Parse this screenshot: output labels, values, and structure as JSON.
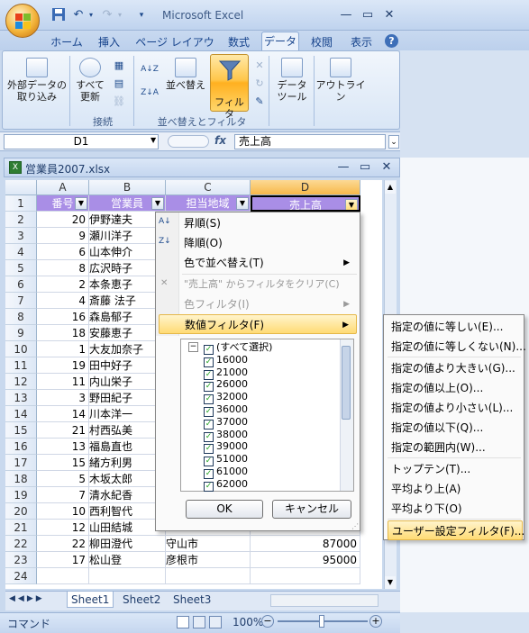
{
  "app": {
    "title": "Microsoft Excel",
    "workbook": "営業員2007.xlsx"
  },
  "qat": [
    "save-icon",
    "undo-icon",
    "redo-icon",
    "customize-icon"
  ],
  "window_controls": [
    "minimize",
    "restore",
    "close"
  ],
  "tabs": [
    "ホーム",
    "挿入",
    "ページ レイアウト",
    "数式",
    "データ",
    "校閲",
    "表示"
  ],
  "active_tab": "データ",
  "ribbon": {
    "external_data": "外部データの取り込み",
    "refresh_all_l1": "すべて",
    "refresh_all_l2": "更新",
    "group_connections": "接続",
    "sort": "並べ替え",
    "filter": "フィルタ",
    "group_sort_filter": "並べ替えとフィルタ",
    "data_tools_l1": "データ",
    "data_tools_l2": "ツール",
    "outline": "アウトライン",
    "sort_az": "A↓Z",
    "sort_za": "Z↓A"
  },
  "formula": {
    "namebox": "D1",
    "fx": "fx",
    "value": "売上高"
  },
  "columns": [
    "A",
    "B",
    "C",
    "D"
  ],
  "rows": [
    {
      "n": "1",
      "a": "番号",
      "b": "営業員",
      "c": "担当地域",
      "d": "売上高"
    },
    {
      "n": "2",
      "a": "20",
      "b": "伊野達夫",
      "c": "",
      "d": ""
    },
    {
      "n": "3",
      "a": "9",
      "b": "瀬川洋子",
      "c": "",
      "d": ""
    },
    {
      "n": "4",
      "a": "6",
      "b": "山本伸介",
      "c": "",
      "d": ""
    },
    {
      "n": "5",
      "a": "8",
      "b": "広沢時子",
      "c": "",
      "d": ""
    },
    {
      "n": "6",
      "a": "2",
      "b": "本条恵子",
      "c": "",
      "d": ""
    },
    {
      "n": "7",
      "a": "4",
      "b": "斎藤 法子",
      "c": "",
      "d": ""
    },
    {
      "n": "8",
      "a": "16",
      "b": "森島郁子",
      "c": "",
      "d": ""
    },
    {
      "n": "9",
      "a": "18",
      "b": "安藤恵子",
      "c": "",
      "d": ""
    },
    {
      "n": "10",
      "a": "1",
      "b": "大友加奈子",
      "c": "",
      "d": ""
    },
    {
      "n": "11",
      "a": "19",
      "b": "田中好子",
      "c": "",
      "d": ""
    },
    {
      "n": "12",
      "a": "11",
      "b": "内山栄子",
      "c": "",
      "d": ""
    },
    {
      "n": "13",
      "a": "3",
      "b": "野田紀子",
      "c": "",
      "d": ""
    },
    {
      "n": "14",
      "a": "14",
      "b": "川本洋一",
      "c": "",
      "d": ""
    },
    {
      "n": "15",
      "a": "21",
      "b": "村西弘美",
      "c": "",
      "d": ""
    },
    {
      "n": "16",
      "a": "13",
      "b": "福島直也",
      "c": "",
      "d": ""
    },
    {
      "n": "17",
      "a": "15",
      "b": "緒方利男",
      "c": "",
      "d": ""
    },
    {
      "n": "18",
      "a": "5",
      "b": "木坂太郎",
      "c": "",
      "d": ""
    },
    {
      "n": "19",
      "a": "7",
      "b": "清水紀香",
      "c": "",
      "d": ""
    },
    {
      "n": "20",
      "a": "10",
      "b": "西利智代",
      "c": "",
      "d": ""
    },
    {
      "n": "21",
      "a": "12",
      "b": "山田結城",
      "c": "",
      "d": ""
    },
    {
      "n": "22",
      "a": "22",
      "b": "柳田澄代",
      "c": "守山市",
      "d": "87000"
    },
    {
      "n": "23",
      "a": "17",
      "b": "松山登",
      "c": "彦根市",
      "d": "95000"
    },
    {
      "n": "24",
      "a": "",
      "b": "",
      "c": "",
      "d": ""
    }
  ],
  "sheets": [
    "Sheet1",
    "Sheet2",
    "Sheet3"
  ],
  "status": {
    "mode": "コマンド",
    "zoom": "100%"
  },
  "menu": {
    "sort_asc": "昇順(S)",
    "sort_desc": "降順(O)",
    "sort_color": "色で並べ替え(T)",
    "clear_filter": "\"売上高\" からフィルタをクリア(C)",
    "color_filter": "色フィルタ(I)",
    "number_filter": "数値フィルタ(F)",
    "checklist": [
      "(すべて選択)",
      "16000",
      "21000",
      "26000",
      "32000",
      "36000",
      "37000",
      "38000",
      "39000",
      "51000",
      "61000",
      "62000"
    ],
    "ok": "OK",
    "cancel": "キャンセル"
  },
  "submenu": [
    "指定の値に等しい(E)...",
    "指定の値に等しくない(N)...",
    "指定の値より大きい(G)...",
    "指定の値以上(O)...",
    "指定の値より小さい(L)...",
    "指定の値以下(Q)...",
    "指定の範囲内(W)...",
    "トップテン(T)...",
    "平均より上(A)",
    "平均より下(O)",
    "ユーザー設定フィルタ(F)..."
  ],
  "colors": {
    "header_fill": "#a98ee6",
    "highlight": "#ffdb75",
    "ribbon": "#d9e6f6"
  }
}
